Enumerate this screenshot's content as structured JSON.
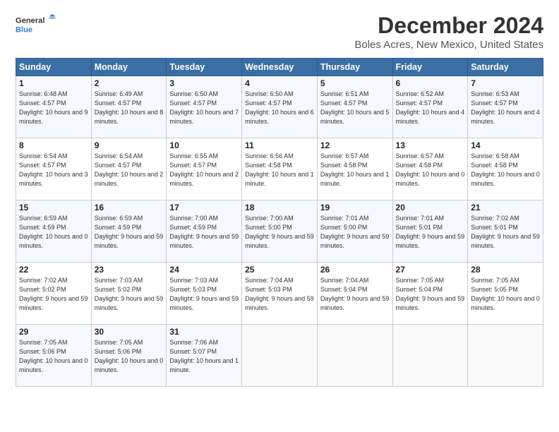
{
  "logo": {
    "text_line1": "General",
    "text_line2": "Blue"
  },
  "title": "December 2024",
  "location": "Boles Acres, New Mexico, United States",
  "days_of_week": [
    "Sunday",
    "Monday",
    "Tuesday",
    "Wednesday",
    "Thursday",
    "Friday",
    "Saturday"
  ],
  "weeks": [
    [
      {
        "day": "1",
        "sunrise": "6:48 AM",
        "sunset": "4:57 PM",
        "daylight": "10 hours and 9 minutes."
      },
      {
        "day": "2",
        "sunrise": "6:49 AM",
        "sunset": "4:57 PM",
        "daylight": "10 hours and 8 minutes."
      },
      {
        "day": "3",
        "sunrise": "6:50 AM",
        "sunset": "4:57 PM",
        "daylight": "10 hours and 7 minutes."
      },
      {
        "day": "4",
        "sunrise": "6:50 AM",
        "sunset": "4:57 PM",
        "daylight": "10 hours and 6 minutes."
      },
      {
        "day": "5",
        "sunrise": "6:51 AM",
        "sunset": "4:57 PM",
        "daylight": "10 hours and 5 minutes."
      },
      {
        "day": "6",
        "sunrise": "6:52 AM",
        "sunset": "4:57 PM",
        "daylight": "10 hours and 4 minutes."
      },
      {
        "day": "7",
        "sunrise": "6:53 AM",
        "sunset": "4:57 PM",
        "daylight": "10 hours and 4 minutes."
      }
    ],
    [
      {
        "day": "8",
        "sunrise": "6:54 AM",
        "sunset": "4:57 PM",
        "daylight": "10 hours and 3 minutes."
      },
      {
        "day": "9",
        "sunrise": "6:54 AM",
        "sunset": "4:57 PM",
        "daylight": "10 hours and 2 minutes."
      },
      {
        "day": "10",
        "sunrise": "6:55 AM",
        "sunset": "4:57 PM",
        "daylight": "10 hours and 2 minutes."
      },
      {
        "day": "11",
        "sunrise": "6:56 AM",
        "sunset": "4:58 PM",
        "daylight": "10 hours and 1 minute."
      },
      {
        "day": "12",
        "sunrise": "6:57 AM",
        "sunset": "4:58 PM",
        "daylight": "10 hours and 1 minute."
      },
      {
        "day": "13",
        "sunrise": "6:57 AM",
        "sunset": "4:58 PM",
        "daylight": "10 hours and 0 minutes."
      },
      {
        "day": "14",
        "sunrise": "6:58 AM",
        "sunset": "4:58 PM",
        "daylight": "10 hours and 0 minutes."
      }
    ],
    [
      {
        "day": "15",
        "sunrise": "6:59 AM",
        "sunset": "4:59 PM",
        "daylight": "10 hours and 0 minutes."
      },
      {
        "day": "16",
        "sunrise": "6:59 AM",
        "sunset": "4:59 PM",
        "daylight": "9 hours and 59 minutes."
      },
      {
        "day": "17",
        "sunrise": "7:00 AM",
        "sunset": "4:59 PM",
        "daylight": "9 hours and 59 minutes."
      },
      {
        "day": "18",
        "sunrise": "7:00 AM",
        "sunset": "5:00 PM",
        "daylight": "9 hours and 59 minutes."
      },
      {
        "day": "19",
        "sunrise": "7:01 AM",
        "sunset": "5:00 PM",
        "daylight": "9 hours and 59 minutes."
      },
      {
        "day": "20",
        "sunrise": "7:01 AM",
        "sunset": "5:01 PM",
        "daylight": "9 hours and 59 minutes."
      },
      {
        "day": "21",
        "sunrise": "7:02 AM",
        "sunset": "5:01 PM",
        "daylight": "9 hours and 59 minutes."
      }
    ],
    [
      {
        "day": "22",
        "sunrise": "7:02 AM",
        "sunset": "5:02 PM",
        "daylight": "9 hours and 59 minutes."
      },
      {
        "day": "23",
        "sunrise": "7:03 AM",
        "sunset": "5:02 PM",
        "daylight": "9 hours and 59 minutes."
      },
      {
        "day": "24",
        "sunrise": "7:03 AM",
        "sunset": "5:03 PM",
        "daylight": "9 hours and 59 minutes."
      },
      {
        "day": "25",
        "sunrise": "7:04 AM",
        "sunset": "5:03 PM",
        "daylight": "9 hours and 59 minutes."
      },
      {
        "day": "26",
        "sunrise": "7:04 AM",
        "sunset": "5:04 PM",
        "daylight": "9 hours and 59 minutes."
      },
      {
        "day": "27",
        "sunrise": "7:05 AM",
        "sunset": "5:04 PM",
        "daylight": "9 hours and 59 minutes."
      },
      {
        "day": "28",
        "sunrise": "7:05 AM",
        "sunset": "5:05 PM",
        "daylight": "10 hours and 0 minutes."
      }
    ],
    [
      {
        "day": "29",
        "sunrise": "7:05 AM",
        "sunset": "5:06 PM",
        "daylight": "10 hours and 0 minutes."
      },
      {
        "day": "30",
        "sunrise": "7:05 AM",
        "sunset": "5:06 PM",
        "daylight": "10 hours and 0 minutes."
      },
      {
        "day": "31",
        "sunrise": "7:06 AM",
        "sunset": "5:07 PM",
        "daylight": "10 hours and 1 minute."
      },
      null,
      null,
      null,
      null
    ]
  ],
  "labels": {
    "sunrise": "Sunrise:",
    "sunset": "Sunset:",
    "daylight": "Daylight:"
  }
}
